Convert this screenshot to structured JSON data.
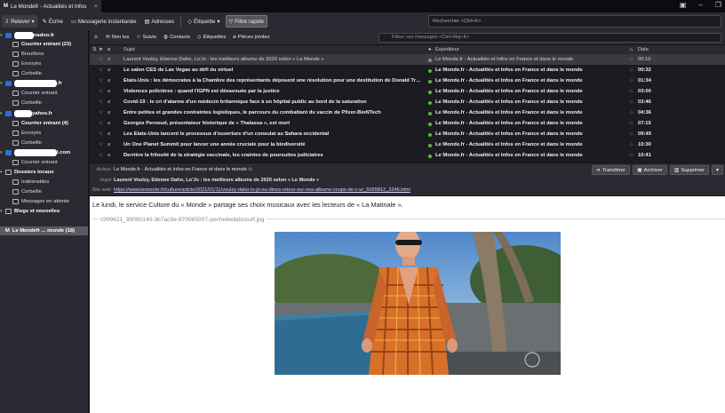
{
  "window": {
    "tab_title": "Le Mondefr - Actualités et Infos"
  },
  "toolbar": {
    "get_mail": "Relever",
    "write": "Écrire",
    "chat": "Messagerie instantanée",
    "address_book": "Adresses",
    "tag": "Étiquette",
    "quick_filter": "Filtre rapide",
    "search_placeholder": "Rechercher <Ctrl+K>"
  },
  "folders": {
    "account1_suffix": "nadoo.fr",
    "account2_suffix": ".fr",
    "account3_suffix": "yahoo.fr",
    "account4_suffix": "l.com",
    "items": [
      {
        "label": "Courrier entrant (23)"
      },
      {
        "label": "Brouillons"
      },
      {
        "label": "Envoyés"
      },
      {
        "label": "Corbeille"
      },
      {
        "label": "Courrier entrant"
      },
      {
        "label": "Corbeille"
      },
      {
        "label": "Courrier entrant (4)"
      },
      {
        "label": "Envoyés"
      },
      {
        "label": "Corbeille"
      },
      {
        "label": "Courrier entrant"
      },
      {
        "label": "Dossiers locaux"
      },
      {
        "label": "Indésirables"
      },
      {
        "label": "Corbeille"
      },
      {
        "label": "Messages en attente"
      },
      {
        "label": "Blogs et nouvelles"
      },
      {
        "label": "Le Mondefr ... monde (18)"
      }
    ]
  },
  "quickfilter": {
    "unread": "Non lus",
    "starred": "Suivis",
    "contacts": "Contacts",
    "tags": "Étiquettes",
    "attachments": "Pièces jointes",
    "filter_placeholder": "Filtrer ces messages <Ctrl+Maj+K>"
  },
  "thread_columns": {
    "subject": "Sujet",
    "sender": "Expéditeur",
    "date": "Date"
  },
  "messages": [
    {
      "subject": "Laurent Voulzy, Etienne Daho, Lo'Jo : les meilleurs albums de 2020 selon « Le Monde »",
      "sender": "Le Monde.fr - Actualités et Infos en France et dans le monde",
      "date": "00:10"
    },
    {
      "subject": "Le salon CES de Las Vegas au défi du virtuel",
      "sender": "Le Monde.fr - Actualités et Infos en France et dans le monde",
      "date": "00:32"
    },
    {
      "subject": "Etats-Unis : les démocrates à la Chambre des représentants déposent une résolution pour une destitution de Donald Tru...",
      "sender": "Le Monde.fr - Actualités et Infos en France et dans le monde",
      "date": "01:34"
    },
    {
      "subject": "Violences policières : quand l'IGPN est désavouée par la justice",
      "sender": "Le Monde.fr - Actualités et Infos en France et dans le monde",
      "date": "03:00"
    },
    {
      "subject": "Covid-19 : le cri d'alarme d'un médecin britannique face à un hôpital public au bord de la saturation",
      "sender": "Le Monde.fr - Actualités et Infos en France et dans le monde",
      "date": "03:46"
    },
    {
      "subject": "Entre petites et grandes contraintes logistiques, le parcours du combattant du vaccin de Pfizer-BioNTech",
      "sender": "Le Monde.fr - Actualités et Infos en France et dans le monde",
      "date": "04:36"
    },
    {
      "subject": "Georges Pernoud, présentateur historique de « Thalassa », est mort",
      "sender": "Le Monde.fr - Actualités et Infos en France et dans le monde",
      "date": "07:15"
    },
    {
      "subject": "Les Etats-Unis lancent le processus d'ouverture d'un consulat au Sahara occidental",
      "sender": "Le Monde.fr - Actualités et Infos en France et dans le monde",
      "date": "09:49"
    },
    {
      "subject": "Un One Planet Summit pour lancer une année cruciale pour la biodiversité",
      "sender": "Le Monde.fr - Actualités et Infos en France et dans le monde",
      "date": "10:30"
    },
    {
      "subject": "Derrière la frilosité de la stratégie vaccinale, les craintes de poursuites judiciaires",
      "sender": "Le Monde.fr - Actualités et Infos en France et dans le monde",
      "date": "10:41"
    }
  ],
  "message_header": {
    "author_label": "Auteur",
    "author": "Le Monde.fr - Actualités et Infos en France et dans le monde ✩",
    "subject_label": "Sujet",
    "subject": "Laurent Voulzy, Etienne Daho, Lo'Jo : les meilleurs albums de 2020 selon « Le Monde »",
    "website_label": "Site web",
    "website": "https://www.lemonde.fr/culture/article/2021/01/11/voulzy-daho-lo-jo-ou-dinos-retour-sur-nos-albums-coups-de-c-ur_6065812_3246.html",
    "forward": "Transférer",
    "archive": "Archiver",
    "delete": "Supprimer"
  },
  "message_body": {
    "intro": "Le lundi, le service Culture du « Monde » partage ses choix musicaux avec les lecteurs de « La Matinale ».",
    "attachment": "c999621_90080140-3b7ac5e-870085007-pochetledahosurf.jpg"
  },
  "colors": {
    "unread_dot": "#5fb93f",
    "account_icon": "#2a6fd6"
  }
}
